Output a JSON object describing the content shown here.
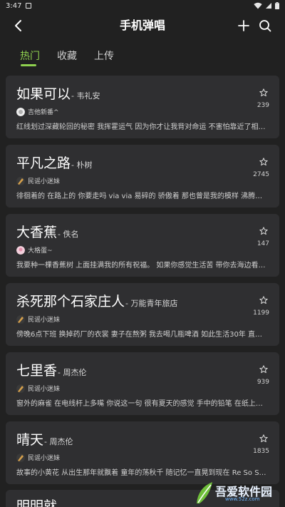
{
  "status_bar": {
    "time": "3:47"
  },
  "header": {
    "title": "手机弹唱"
  },
  "tabs": [
    {
      "label": "热门",
      "active": true
    },
    {
      "label": "收藏",
      "active": false
    },
    {
      "label": "上传",
      "active": false
    }
  ],
  "songs": [
    {
      "name": "如果可以",
      "artist": "- 韦礼安",
      "user": "吉他新番^",
      "count": "239",
      "desc": "红线划过深藏轮回的秘密 我挥霍运气 因为你才让我背对命运 不害怕靠近了相…"
    },
    {
      "name": "平凡之路",
      "artist": "- 朴树",
      "user": "民谣小迷妹",
      "count": "2745",
      "desc": "徘徊着的 在路上的 你要走吗 via via 易碎的 骄傲着 那也曾是我的模样 沸腾着的 …"
    },
    {
      "name": "大香蕉",
      "artist": "- 佚名",
      "user": "大格蛋~",
      "count": "147",
      "desc": "我要种一棵香蕉树 上面挂满我的所有祝福。 如果你感觉生活苦 带你去海边看…"
    },
    {
      "name": "杀死那个石家庄人",
      "artist": "- 万能青年旅店",
      "user": "民谣小迷妹",
      "count": "1199",
      "desc": "傍晚6点下班 换掉药厂的衣裳 妻子在熬粥 我去喝几瓶啤酒 如此生活30年 直到…"
    },
    {
      "name": "七里香",
      "artist": "- 周杰伦",
      "user": "民谣小迷妹",
      "count": "939",
      "desc": "窗外的麻雀 在电线杆上多嘴 你说这一句 很有夏天的感觉 手中的铅笔 在纸上来…"
    },
    {
      "name": "晴天",
      "artist": "- 周杰伦",
      "user": "民谣小迷妹",
      "count": "1835",
      "desc": "故事的小黄花 从出生那年就飘着 童年的荡秋千 随记忆一直晃到现在 Re So So S…"
    }
  ],
  "partial_song": {
    "name": "明明就"
  },
  "watermark": {
    "text": "吾爱软件园",
    "url": "www.52z.com"
  },
  "colors": {
    "background": "#212121",
    "card": "#2f2f31",
    "accent": "#8fd14f"
  }
}
